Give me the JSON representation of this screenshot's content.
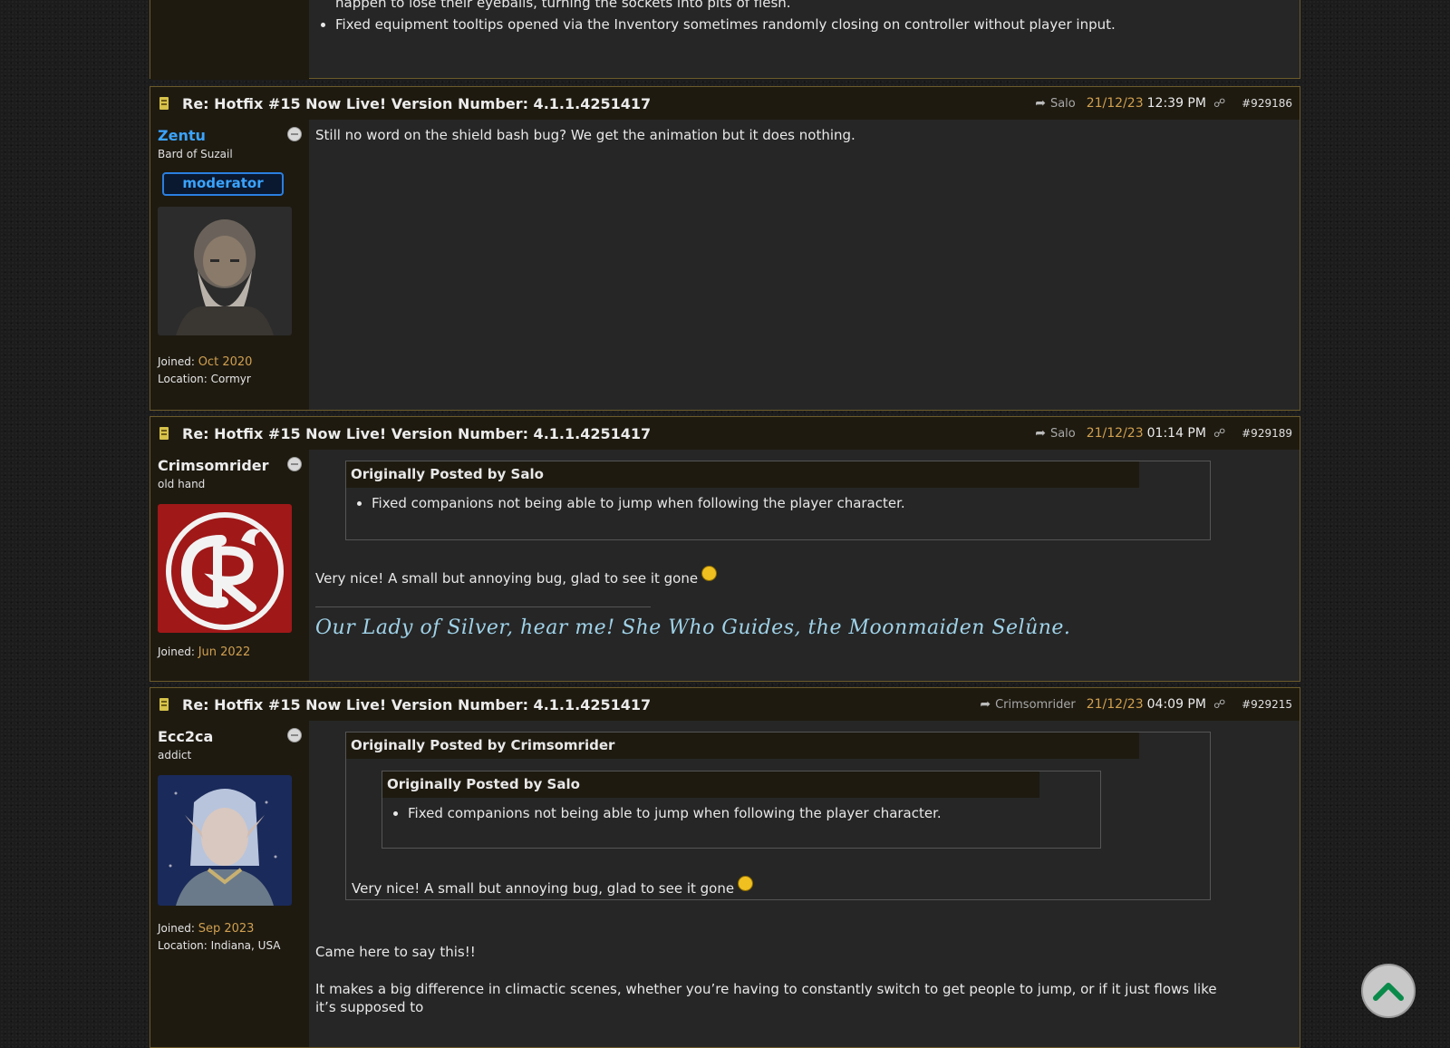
{
  "top_post": {
    "bullets": [
      "happen to lose their eyeballs, turning the sockets into pits of flesh.",
      "Fixed equipment tooltips opened via the Inventory sometimes randomly closing on controller without player input."
    ]
  },
  "posts": [
    {
      "subject": "Re: Hotfix #15 Now Live! Version Number: 4.1.1.4251417",
      "reply_to": "Salo",
      "date": "21/12/23",
      "time": "12:39 PM",
      "number": "#929186",
      "user": {
        "name": "Zentu",
        "title": "Bard of Suzail",
        "badge": "moderator",
        "joined_label": "Joined:",
        "joined": "Oct 2020",
        "location_label": "Location:",
        "location": "Cormyr"
      },
      "message": "Still no word on the shield bash bug? We get the animation but it does nothing."
    },
    {
      "subject": "Re: Hotfix #15 Now Live! Version Number: 4.1.1.4251417",
      "reply_to": "Salo",
      "date": "21/12/23",
      "time": "01:14 PM",
      "number": "#929189",
      "user": {
        "name": "Crimsomrider",
        "title": "old hand",
        "joined_label": "Joined:",
        "joined": "Jun 2022"
      },
      "quote": {
        "header": "Originally Posted by Salo",
        "bullet": "Fixed companions not being able to jump when following the player character."
      },
      "message": "Very nice! A small but annoying bug, glad to see it gone",
      "signature": "Our Lady of Silver, hear me! She Who Guides, the Moonmaiden Selûne."
    },
    {
      "subject": "Re: Hotfix #15 Now Live! Version Number: 4.1.1.4251417",
      "reply_to": "Crimsomrider",
      "date": "21/12/23",
      "time": "04:09 PM",
      "number": "#929215",
      "user": {
        "name": "Ecc2ca",
        "title": "addict",
        "joined_label": "Joined:",
        "joined": "Sep 2023",
        "location_label": "Location:",
        "location": "Indiana, USA"
      },
      "outer_quote": {
        "header": "Originally Posted by Crimsomrider",
        "message": "Very nice! A small but annoying bug, glad to see it gone"
      },
      "inner_quote": {
        "header": "Originally Posted by Salo",
        "bullet": "Fixed companions not being able to jump when following the player character."
      },
      "message_1": "Came here to say this!!",
      "message_2": "It makes a big difference in climactic scenes, whether you’re having to constantly switch to get people to jump, or if it just flows like it’s supposed to"
    }
  ],
  "colors": {
    "accent_gold": "#d0a050",
    "moderator_blue": "#3aa4ff",
    "scroll_arrow": "#0a8a4a"
  }
}
